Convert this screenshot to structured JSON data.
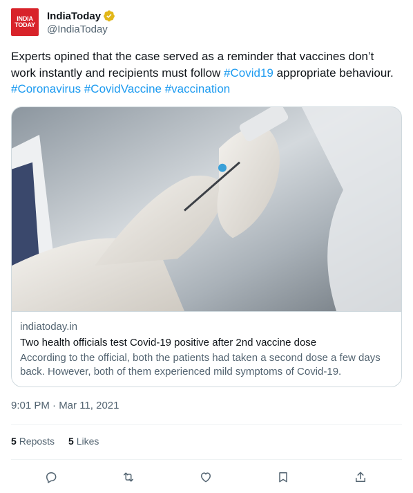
{
  "author": {
    "avatar_line1": "INDIA",
    "avatar_line2": "TODAY",
    "display_name": "IndiaToday",
    "handle": "@IndiaToday",
    "verified": true,
    "verified_badge_color": "#e2b719",
    "avatar_color": "#d8232a"
  },
  "tweet": {
    "text_part1": "Experts opined that the case served as a reminder that vaccines don’t work instantly and recipients must follow ",
    "hashtag1": "#Covid19",
    "text_part2": " appropriate behaviour. ",
    "hashtag2": "#Coronavirus",
    "hashtag3": "#CovidVaccine",
    "hashtag4": "#vaccination",
    "timestamp": "9:01 PM · Mar 11, 2021"
  },
  "card": {
    "domain": "indiatoday.in",
    "title": "Two health officials test Covid-19 positive after 2nd vaccine dose",
    "description": "According to the official, both the patients had taken a second dose a few days back. However, both of them experienced mild symptoms of Covid-19."
  },
  "stats": {
    "reposts_count": "5",
    "reposts_label": "Reposts",
    "likes_count": "5",
    "likes_label": "Likes"
  },
  "actions": {
    "icons": [
      "reply-icon",
      "repost-icon",
      "like-icon",
      "bookmark-icon",
      "share-icon"
    ]
  },
  "colors": {
    "link": "#1d9bf0",
    "secondary_text": "#536471",
    "primary_text": "#0f1419",
    "border": "#cfd9de"
  }
}
